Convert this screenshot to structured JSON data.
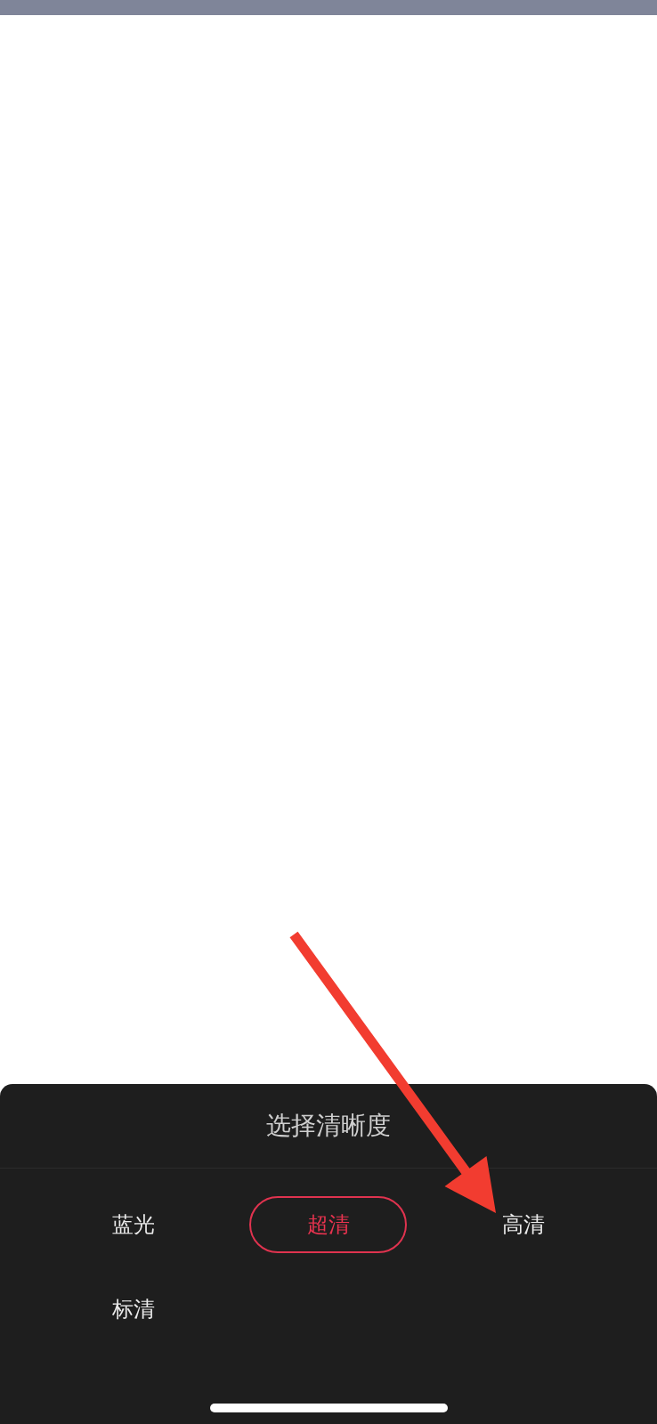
{
  "sheet": {
    "title": "选择清晰度",
    "options": [
      {
        "label": "蓝光",
        "selected": false
      },
      {
        "label": "超清",
        "selected": true
      },
      {
        "label": "高清",
        "selected": false
      },
      {
        "label": "标清",
        "selected": false
      }
    ]
  }
}
